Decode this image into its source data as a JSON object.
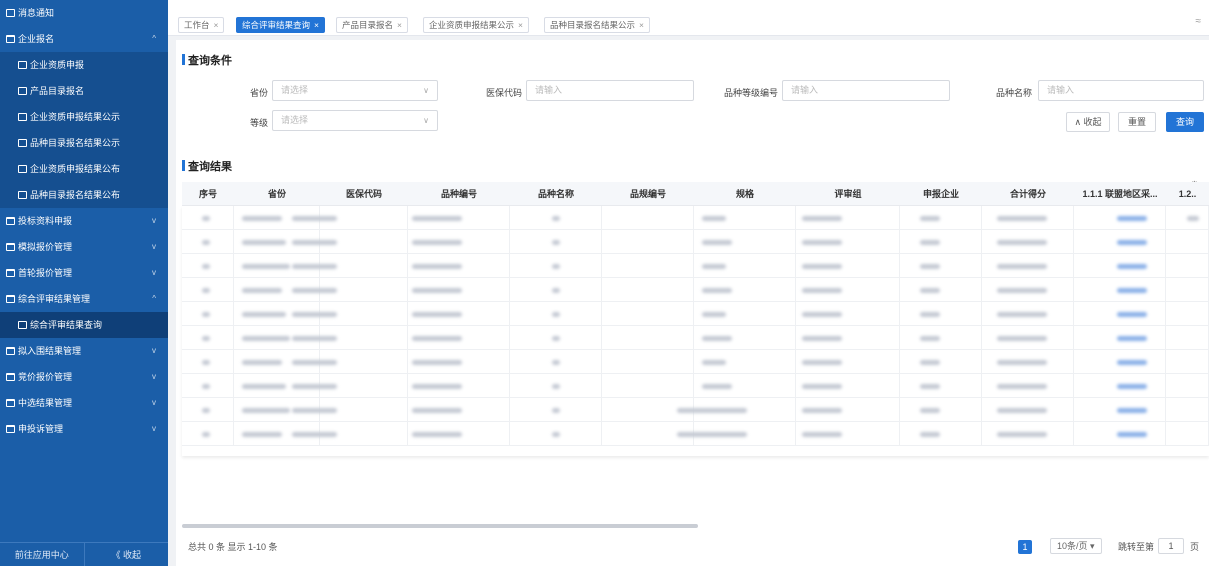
{
  "sidebar": {
    "items": [
      {
        "label": "消息通知",
        "type": "top"
      },
      {
        "label": "企业报名",
        "type": "group",
        "chevron": "^"
      },
      {
        "label": "企业资质申报",
        "type": "sub"
      },
      {
        "label": "产品目录报名",
        "type": "sub"
      },
      {
        "label": "企业资质申报结果公示",
        "type": "sub"
      },
      {
        "label": "品种目录报名结果公示",
        "type": "sub"
      },
      {
        "label": "企业资质申报结果公布",
        "type": "sub"
      },
      {
        "label": "品种目录报名结果公布",
        "type": "sub"
      },
      {
        "label": "投标资料申报",
        "type": "group",
        "chevron": "v"
      },
      {
        "label": "模拟报价管理",
        "type": "group",
        "chevron": "v"
      },
      {
        "label": "首轮报价管理",
        "type": "group",
        "chevron": "v"
      },
      {
        "label": "综合评审结果管理",
        "type": "group",
        "chevron": "^"
      },
      {
        "label": "综合评审结果查询",
        "type": "sub-active"
      },
      {
        "label": "拟入围结果管理",
        "type": "group",
        "chevron": "v"
      },
      {
        "label": "竞价报价管理",
        "type": "group",
        "chevron": "v"
      },
      {
        "label": "中选结果管理",
        "type": "group",
        "chevron": "v"
      },
      {
        "label": "申投诉管理",
        "type": "group",
        "chevron": "v"
      }
    ],
    "bottom": {
      "app_center": "前往应用中心",
      "collapse": "《 收起"
    }
  },
  "tabs": [
    {
      "label": "工作台",
      "active": false
    },
    {
      "label": "综合评审结果查询",
      "active": true
    },
    {
      "label": "产品目录报名",
      "active": false
    },
    {
      "label": "企业资质申报结果公示",
      "active": false
    },
    {
      "label": "品种目录报名结果公示",
      "active": false
    }
  ],
  "tab_close": "×",
  "query": {
    "title": "查询条件",
    "province": {
      "label": "省份",
      "placeholder": "请选择"
    },
    "insurance_code": {
      "label": "医保代码",
      "placeholder": "请输入"
    },
    "variety_grade_code": {
      "label": "品种等级编号",
      "placeholder": "请输入"
    },
    "variety_name": {
      "label": "品种名称",
      "placeholder": "请输入"
    },
    "grade": {
      "label": "等级",
      "placeholder": "请选择"
    },
    "collapse_btn": "∧ 收起",
    "reset_btn": "重置",
    "search_btn": "查询"
  },
  "results": {
    "title": "查询结果",
    "columns": [
      "序号",
      "省份",
      "医保代码",
      "品种编号",
      "品种名称",
      "品规编号",
      "规格",
      "评审组",
      "申报企业",
      "合计得分",
      "1.1.1 联盟地区采...",
      "1.2.."
    ],
    "row_count": 10
  },
  "footer": {
    "summary": "总共 0 条 显示 1-10 条",
    "current_page": "1",
    "page_size": "10条/页 ▾",
    "jump_label": "跳转至第",
    "jump_value": "1",
    "page_unit": "页"
  },
  "colors": {
    "primary": "#2274d6",
    "sidebar": "#1b5ea8"
  }
}
